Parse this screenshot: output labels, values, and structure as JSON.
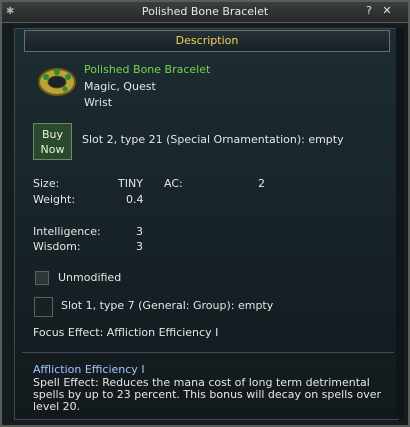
{
  "window": {
    "title": "Polished Bone Bracelet",
    "help_label": "?",
    "close_label": "✕"
  },
  "description": {
    "header": "Description"
  },
  "item": {
    "name": "Polished Bone Bracelet",
    "flags": "Magic, Quest",
    "slot": "Wrist",
    "buy_label": "Buy Now",
    "slot2_text": "Slot 2, type 21 (Special Ornamentation): empty"
  },
  "stats": {
    "size_label": "Size:",
    "size_value": "TINY",
    "ac_label": "AC:",
    "ac_value": "2",
    "weight_label": "Weight:",
    "weight_value": "0.4",
    "int_label": "Intelligence:",
    "int_value": "3",
    "wis_label": "Wisdom:",
    "wis_value": "3"
  },
  "misc": {
    "unmodified": "Unmodified",
    "slot1_text": "Slot 1, type 7 (General: Group): empty",
    "focus": "Focus Effect: Affliction Efficiency I"
  },
  "affliction": {
    "title": "Affliction Efficiency I",
    "body": "Spell Effect: Reduces the mana cost of long term detrimental spells by up to 23 percent. This bonus will decay on spells over level 20."
  },
  "colors": {
    "name_green": "#7ad34a",
    "header_gold": "#f3d15b",
    "link_blue": "#9fc7ff"
  }
}
